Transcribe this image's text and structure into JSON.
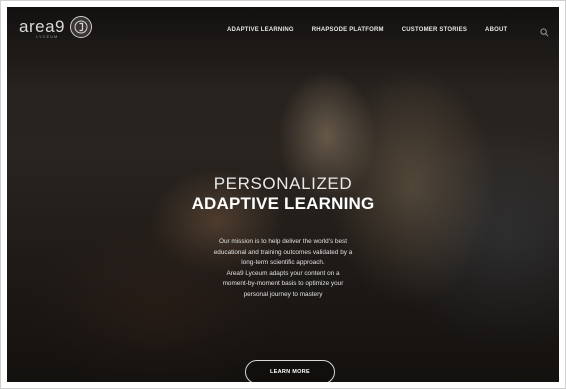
{
  "logo": {
    "word": "area9",
    "sub": "LYCEUM"
  },
  "nav": {
    "items": [
      "ADAPTIVE LEARNING",
      "RHAPSODE PLATFORM",
      "CUSTOMER STORIES",
      "ABOUT"
    ],
    "search_icon": "search-icon"
  },
  "hero": {
    "title_line1": "PERSONALIZED",
    "title_line2": "ADAPTIVE LEARNING",
    "description_lines": [
      "Our mission is to help deliver the world's best",
      "educational and training outcomes validated by a",
      "long-term scientific approach.",
      "Area9 Lyceum adapts your content on a",
      "moment-by-moment basis to optimize your",
      "personal journey to mastery"
    ],
    "cta_label": "LEARN MORE"
  },
  "colors": {
    "nav_text": "#e6e6e6",
    "hero_text": "#ffffff",
    "cta_border": "#d8d8d8"
  }
}
